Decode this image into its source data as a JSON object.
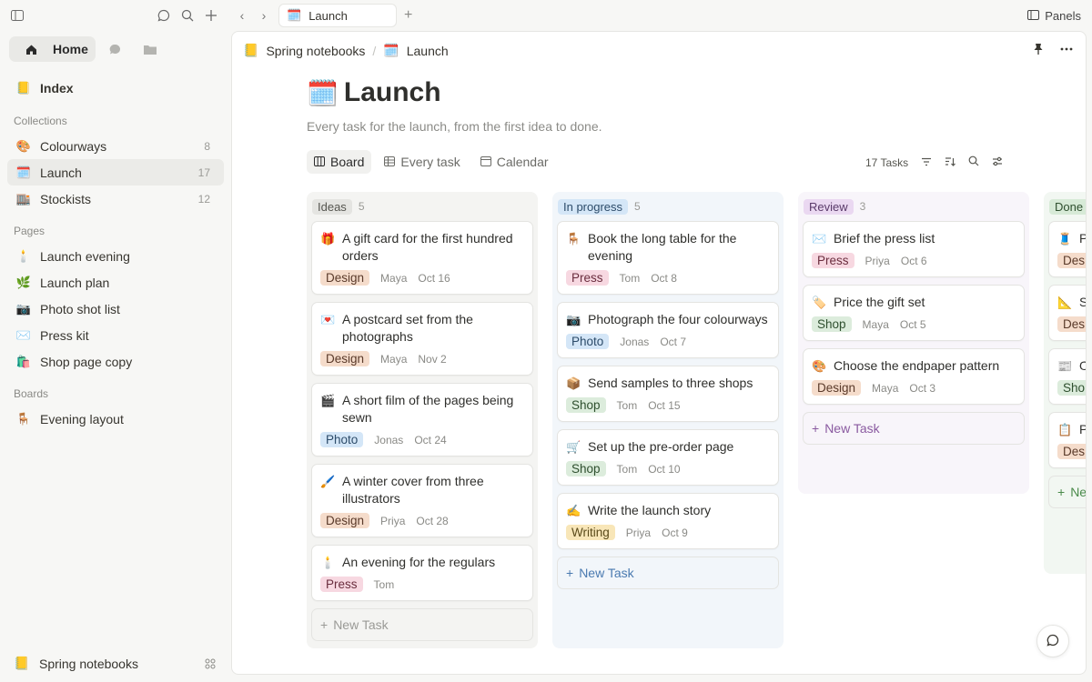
{
  "colors": {
    "design": "#f5dccb",
    "press": "#f7d8e1",
    "photo": "#d4e6f7",
    "shop": "#dcecdc",
    "writing": "#f8e6b8",
    "ideas_tag": "#e4e4e1",
    "progress_tag": "#d4e6f7",
    "review_tag": "#ead8f1",
    "done_tag": "#d7ead7"
  },
  "sidebar": {
    "home_label": "Home",
    "index_label": "Index",
    "index_icon": "📒",
    "collections_label": "Collections",
    "collections": [
      {
        "icon": "🎨",
        "label": "Colourways",
        "count": "8"
      },
      {
        "icon": "🗓️",
        "label": "Launch",
        "count": "17"
      },
      {
        "icon": "🏬",
        "label": "Stockists",
        "count": "12"
      }
    ],
    "pages_label": "Pages",
    "pages": [
      {
        "icon": "🕯️",
        "label": "Launch evening"
      },
      {
        "icon": "🌿",
        "label": "Launch plan"
      },
      {
        "icon": "📷",
        "label": "Photo shot list"
      },
      {
        "icon": "✉️",
        "label": "Press kit"
      },
      {
        "icon": "🛍️",
        "label": "Shop page copy"
      }
    ],
    "boards_label": "Boards",
    "boards": [
      {
        "icon": "🪑",
        "label": "Evening layout"
      }
    ],
    "workspace_icon": "📒",
    "workspace_label": "Spring notebooks"
  },
  "tabbar": {
    "tab_icon": "🗓️",
    "tab_label": "Launch",
    "panels_label": "Panels"
  },
  "page": {
    "crumb_1_icon": "📒",
    "crumb_1": "Spring notebooks",
    "crumb_2_icon": "🗓️",
    "crumb_2": "Launch",
    "title_icon": "🗓️",
    "title": "Launch",
    "subtitle": "Every task for the launch, from the first idea to done.",
    "views": [
      "Board",
      "Every task",
      "Calendar"
    ],
    "task_count": "17 Tasks",
    "new_task_label": "New Task"
  },
  "board": {
    "columns": [
      {
        "name": "Ideas",
        "count": "5",
        "cards": [
          {
            "icon": "🎁",
            "title": "A gift card for the first hundred orders",
            "tag": "Design",
            "person": "Maya",
            "date": "Oct 16"
          },
          {
            "icon": "💌",
            "title": "A postcard set from the photographs",
            "tag": "Design",
            "person": "Maya",
            "date": "Nov 2"
          },
          {
            "icon": "🎬",
            "title": "A short film of the pages being sewn",
            "tag": "Photo",
            "person": "Jonas",
            "date": "Oct 24"
          },
          {
            "icon": "🖌️",
            "title": "A winter cover from three illustrators",
            "tag": "Design",
            "person": "Priya",
            "date": "Oct 28"
          },
          {
            "icon": "🕯️",
            "title": "An evening for the regulars",
            "tag": "Press",
            "person": "Tom",
            "date": ""
          }
        ]
      },
      {
        "name": "In progress",
        "count": "5",
        "cards": [
          {
            "icon": "🪑",
            "title": "Book the long table for the evening",
            "tag": "Press",
            "person": "Tom",
            "date": "Oct 8"
          },
          {
            "icon": "📷",
            "title": "Photograph the four colourways",
            "tag": "Photo",
            "person": "Jonas",
            "date": "Oct 7"
          },
          {
            "icon": "📦",
            "title": "Send samples to three shops",
            "tag": "Shop",
            "person": "Tom",
            "date": "Oct 15"
          },
          {
            "icon": "🛒",
            "title": "Set up the pre-order page",
            "tag": "Shop",
            "person": "Tom",
            "date": "Oct 10"
          },
          {
            "icon": "✍️",
            "title": "Write the launch story",
            "tag": "Writing",
            "person": "Priya",
            "date": "Oct 9"
          }
        ]
      },
      {
        "name": "Review",
        "count": "3",
        "cards": [
          {
            "icon": "✉️",
            "title": "Brief the press list",
            "tag": "Press",
            "person": "Priya",
            "date": "Oct 6"
          },
          {
            "icon": "🏷️",
            "title": "Price the gift set",
            "tag": "Shop",
            "person": "Maya",
            "date": "Oct 5"
          },
          {
            "icon": "🎨",
            "title": "Choose the endpaper pattern",
            "tag": "Design",
            "person": "Maya",
            "date": "Oct 3"
          }
        ]
      },
      {
        "name": "Done",
        "count": "",
        "cards": [
          {
            "icon": "🧵",
            "title": "P bi",
            "tag": "Des",
            "person": "",
            "date": ""
          },
          {
            "icon": "📐",
            "title": "S",
            "tag": "Des",
            "person": "",
            "date": ""
          },
          {
            "icon": "📰",
            "title": "O",
            "tag": "Sho",
            "person": "",
            "date": ""
          },
          {
            "icon": "📋",
            "title": "P th",
            "tag": "Des",
            "person": "",
            "date": ""
          }
        ]
      }
    ]
  }
}
